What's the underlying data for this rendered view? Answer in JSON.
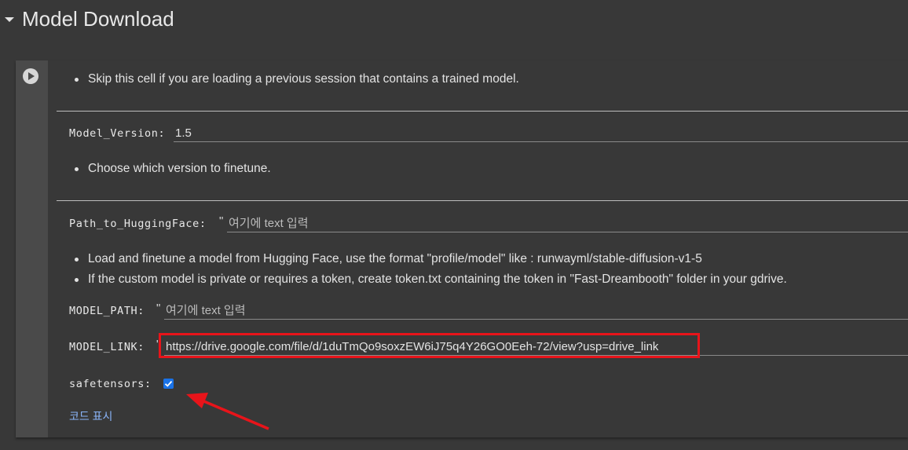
{
  "section": {
    "title": "Model Download"
  },
  "cell": {
    "notes": {
      "skip": "Skip this cell if you are loading a previous session that contains a trained model.",
      "version": "Choose which version to finetune.",
      "hf_format": "Load and finetune a model from Hugging Face, use the format \"profile/model\" like : runwayml/stable-diffusion-v1-5",
      "hf_token": "If the custom model is private or requires a token, create token.txt containing the token in \"Fast-Dreambooth\" folder in your gdrive."
    },
    "fields": {
      "model_version": {
        "label": "Model_Version:",
        "value": "1.5"
      },
      "path_to_huggingface": {
        "label": "Path_to_HuggingFace:",
        "quote": "\"",
        "placeholder": "여기에 text 입력"
      },
      "model_path": {
        "label": "MODEL_PATH:",
        "quote": "\"",
        "placeholder": "여기에 text 입력"
      },
      "model_link": {
        "label": "MODEL_LINK:",
        "quote": "\"",
        "value": "https://drive.google.com/file/d/1duTmQo9soxzEW6iJ75q4Y26GO0Eeh-72/view?usp=drive_link"
      },
      "safetensors": {
        "label": "safetensors:",
        "checked": true
      }
    },
    "show_code_label": "코드 표시"
  },
  "annotations": {
    "highlight_color": "#e8141a",
    "arrow_color": "#e8141a"
  },
  "colors": {
    "checkbox": "#1a73e8",
    "link": "#8ab4f8"
  }
}
